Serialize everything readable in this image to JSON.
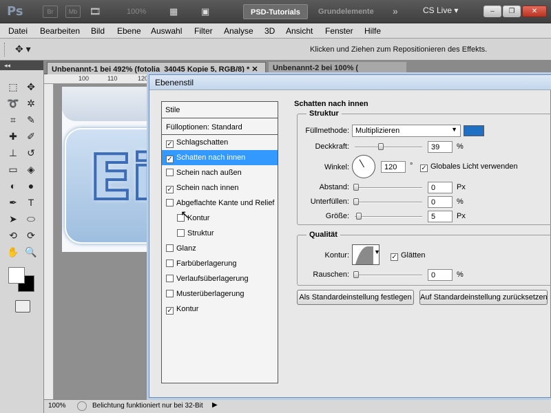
{
  "appbar": {
    "logo": "Ps",
    "bridge_label": "Br",
    "minibridge_label": "Mb",
    "zoom": "100%",
    "workspace_active": "PSD-Tutorials",
    "workspace_inactive": "Grundelemente",
    "more_label": "»",
    "cslive": "CS Live ▾",
    "min_label": "–",
    "max_label": "❐",
    "close_label": "✕"
  },
  "menu": {
    "items": [
      "Datei",
      "Bearbeiten",
      "Bild",
      "Ebene",
      "Auswahl",
      "Filter",
      "Analyse",
      "3D",
      "Ansicht",
      "Fenster",
      "Hilfe"
    ]
  },
  "options": {
    "tool": "✥ ▾",
    "hint": "Klicken und Ziehen zum Repositionieren des Effekts."
  },
  "document": {
    "tab1": "Unbenannt-1 bei 492% (fotolia_34045 Kopie 5, RGB/8) * ✕",
    "tab2": "Unbenannt-2 bei 100% (",
    "ruler": [
      "100",
      "110",
      "120"
    ],
    "art_text": "Ei"
  },
  "status": {
    "zoom": "100%",
    "message": "Belichtung funktioniert nur bei 32-Bit",
    "play": "▶"
  },
  "dialog": {
    "title": "Ebenenstil",
    "styles_header": "Stile",
    "fill_options": "Fülloptionen: Standard",
    "styles": [
      {
        "label": "Schlagschatten",
        "checked": "✓"
      },
      {
        "label": "Schatten nach innen",
        "checked": "✓"
      },
      {
        "label": "Schein nach außen",
        "checked": ""
      },
      {
        "label": "Schein nach innen",
        "checked": "✓"
      },
      {
        "label": "Abgeflachte Kante und Relief",
        "checked": ""
      },
      {
        "label": "Kontur",
        "checked": ""
      },
      {
        "label": "Struktur",
        "checked": ""
      },
      {
        "label": "Glanz",
        "checked": ""
      },
      {
        "label": "Farbüberlagerung",
        "checked": ""
      },
      {
        "label": "Verlaufsüberlagerung",
        "checked": ""
      },
      {
        "label": "Musterüberlagerung",
        "checked": ""
      },
      {
        "label": "Kontur",
        "checked": "✓"
      }
    ],
    "section": "Schatten nach innen",
    "structure": {
      "title": "Struktur",
      "blend_label": "Füllmethode:",
      "blend_value": "Multiplizieren",
      "color": "#1f6fc4",
      "opacity_label": "Deckkraft:",
      "opacity_value": "39",
      "opacity_unit": "%",
      "opacity_fraction": 0.39,
      "angle_label": "Winkel:",
      "angle_value": "120",
      "angle_unit": "°",
      "global_light": "Globales Licht verwenden",
      "global_light_checked": "✓",
      "distance_label": "Abstand:",
      "distance_value": "0",
      "distance_unit": "Px",
      "choke_label": "Unterfüllen:",
      "choke_value": "0",
      "choke_unit": "%",
      "size_label": "Größe:",
      "size_value": "5",
      "size_unit": "Px"
    },
    "quality": {
      "title": "Qualität",
      "contour_label": "Kontur:",
      "antialias": "Glätten",
      "antialias_checked": "✓",
      "noise_label": "Rauschen:",
      "noise_value": "0",
      "noise_unit": "%"
    },
    "buttons": {
      "make_default": "Als Standardeinstellung festlegen",
      "reset_default": "Auf Standardeinstellung zurücksetzen"
    }
  }
}
